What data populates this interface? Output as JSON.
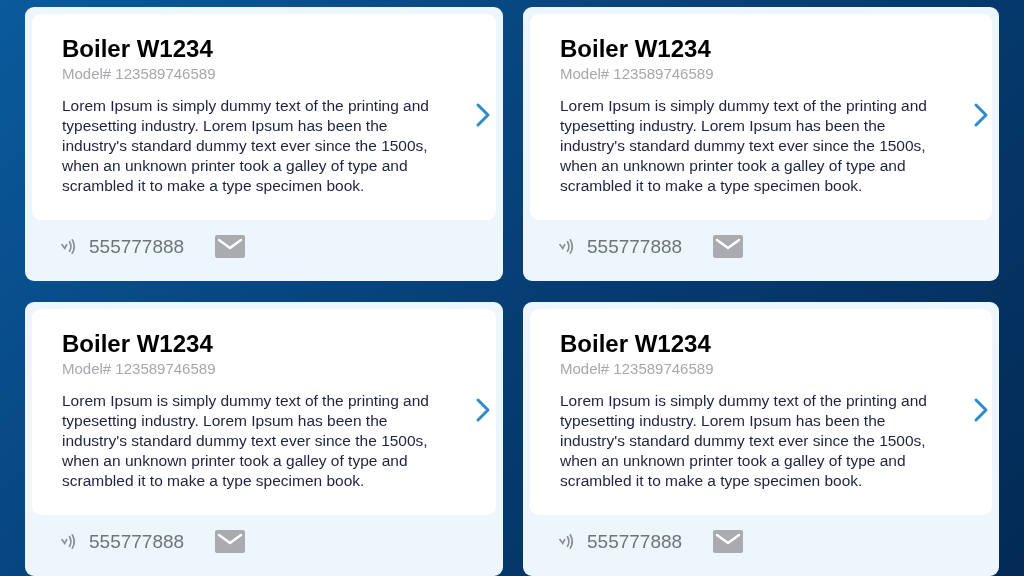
{
  "cards": [
    {
      "title": "Boiler W1234",
      "model": "Model# 123589746589",
      "description": "Lorem Ipsum is simply dummy text of the printing and typesetting industry. Lorem Ipsum has been the industry's standard dummy text ever since the 1500s, when an unknown printer took a galley of type and scrambled it to make a type specimen book.",
      "phone": "555777888"
    },
    {
      "title": "Boiler W1234",
      "model": "Model# 123589746589",
      "description": "Lorem Ipsum is simply dummy text of the printing and typesetting industry. Lorem Ipsum has been the industry's standard dummy text ever since the 1500s, when an unknown printer took a galley of type and scrambled it to make a type specimen book.",
      "phone": "555777888"
    },
    {
      "title": "Boiler W1234",
      "model": "Model# 123589746589",
      "description": "Lorem Ipsum is simply dummy text of the printing and typesetting industry. Lorem Ipsum has been the industry's standard dummy text ever since the 1500s, when an unknown printer took a galley of type and scrambled it to make a type specimen book.",
      "phone": "555777888"
    },
    {
      "title": "Boiler W1234",
      "model": "Model# 123589746589",
      "description": "Lorem Ipsum is simply dummy text of the printing and typesetting industry. Lorem Ipsum has been the industry's standard dummy text ever since the 1500s, when an unknown printer took a galley of type and scrambled it to make a type specimen book.",
      "phone": "555777888"
    }
  ]
}
